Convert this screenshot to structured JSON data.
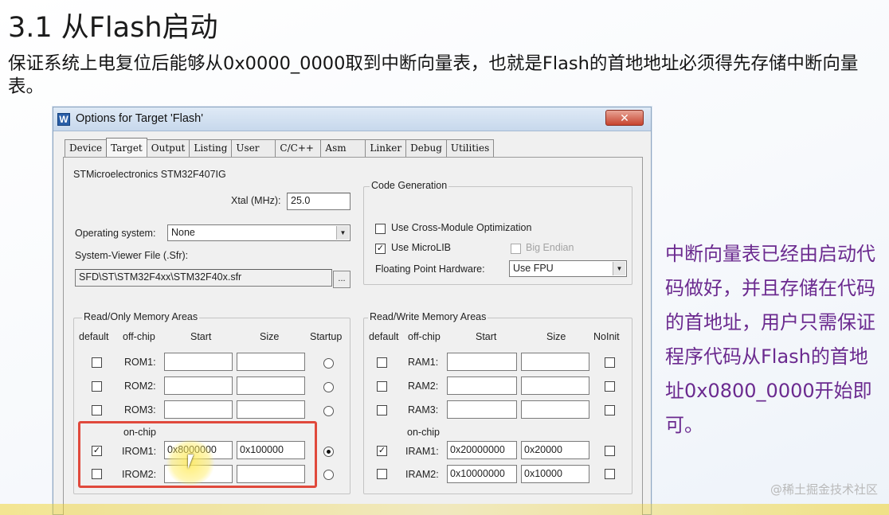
{
  "slide": {
    "title": "3.1 从Flash启动",
    "body": "保证系统上电复位后能够从0x0000_0000取到中断向量表，也就是Flash的首地地址必须得先存储中断向量表。",
    "side_note": "中断向量表已经由启动代码做好，并且存储在代码的首地址，用户只需保证程序代码从Flash的首地址0x0800_0000开始即可。",
    "watermark": "@稀土掘金技术社区"
  },
  "dialog": {
    "title": "Options for Target 'Flash'",
    "close": "✕",
    "tabs": [
      "Device",
      "Target",
      "Output",
      "Listing",
      "User",
      "C/C++",
      "Asm",
      "Linker",
      "Debug",
      "Utilities"
    ],
    "active_tab": "Target",
    "device": "STMicroelectronics STM32F407IG",
    "xtal_label": "Xtal (MHz):",
    "xtal_value": "25.0",
    "os_label": "Operating system:",
    "os_value": "None",
    "sfr_label": "System-Viewer File (.Sfr):",
    "sfr_value": "SFD\\ST\\STM32F4xx\\STM32F40x.sfr",
    "browse": "...",
    "code_gen": {
      "title": "Code Generation",
      "cross_module": "Use Cross-Module Optimization",
      "cross_module_checked": false,
      "microlib": "Use MicroLIB",
      "microlib_checked": true,
      "big_endian": "Big Endian",
      "big_endian_checked": false,
      "fp_label": "Floating Point Hardware:",
      "fp_value": "Use FPU"
    },
    "ro_memory": {
      "title": "Read/Only Memory Areas",
      "headers": {
        "default": "default",
        "offchip": "off-chip",
        "start": "Start",
        "size": "Size",
        "startup": "Startup"
      },
      "onchip_label": "on-chip",
      "rows": [
        {
          "name": "ROM1:",
          "default": false,
          "start": "",
          "size": "",
          "startup": false
        },
        {
          "name": "ROM2:",
          "default": false,
          "start": "",
          "size": "",
          "startup": false
        },
        {
          "name": "ROM3:",
          "default": false,
          "start": "",
          "size": "",
          "startup": false
        },
        {
          "name": "IROM1:",
          "default": true,
          "start": "0x8000000",
          "size": "0x100000",
          "startup": true
        },
        {
          "name": "IROM2:",
          "default": false,
          "start": "",
          "size": "",
          "startup": false
        }
      ]
    },
    "rw_memory": {
      "title": "Read/Write Memory Areas",
      "headers": {
        "default": "default",
        "offchip": "off-chip",
        "start": "Start",
        "size": "Size",
        "noinit": "NoInit"
      },
      "onchip_label": "on-chip",
      "rows": [
        {
          "name": "RAM1:",
          "default": false,
          "start": "",
          "size": "",
          "noinit": false
        },
        {
          "name": "RAM2:",
          "default": false,
          "start": "",
          "size": "",
          "noinit": false
        },
        {
          "name": "RAM3:",
          "default": false,
          "start": "",
          "size": "",
          "noinit": false
        },
        {
          "name": "IRAM1:",
          "default": true,
          "start": "0x20000000",
          "size": "0x20000",
          "noinit": false
        },
        {
          "name": "IRAM2:",
          "default": false,
          "start": "0x10000000",
          "size": "0x10000",
          "noinit": false
        }
      ]
    }
  },
  "colors": {
    "highlight_box": "#e0493c",
    "side_note": "#6b2a8f"
  }
}
